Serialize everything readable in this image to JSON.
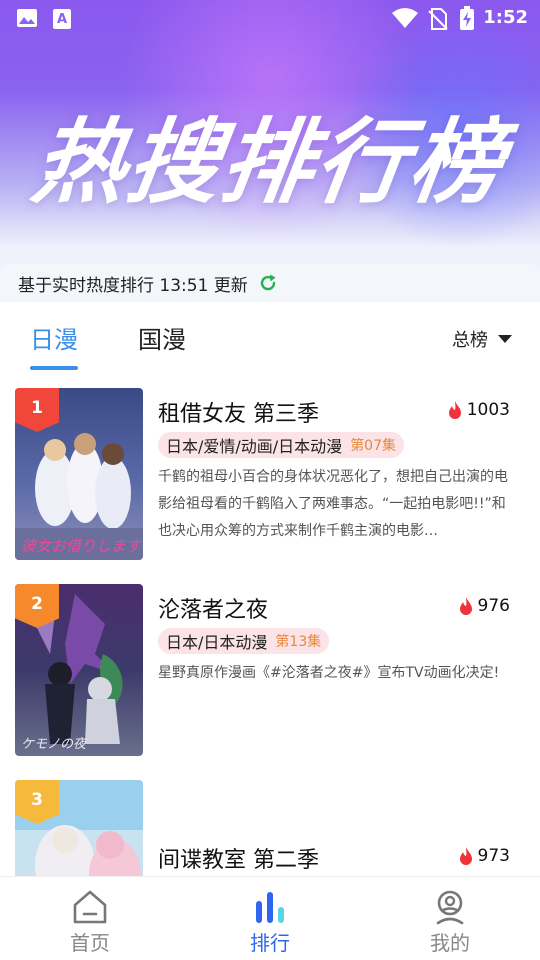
{
  "status_bar": {
    "time": "1:52",
    "left_icons": [
      "image-icon",
      "font-a-icon"
    ],
    "right_icons": [
      "wifi-icon",
      "no-sim-icon",
      "battery-charging-icon"
    ]
  },
  "hero": {
    "title": "热搜排行榜"
  },
  "update": {
    "text": "基于实时热度排行 13:51 更新",
    "icon": "refresh-icon",
    "icon_color": "#22b14c"
  },
  "tabs": {
    "active": "日漫",
    "inactive": "国漫",
    "accent": "#3a8fe8"
  },
  "sort": {
    "label": "总榜"
  },
  "items": [
    {
      "rank": "1",
      "rank_color": "#f0473a",
      "title": "租借女友 第三季",
      "heat": "1003",
      "genre": "日本/爱情/动画/日本动漫",
      "episode": "第07集",
      "desc": "千鹤的祖母小百合的身体状况恶化了，想把自己出演的电影给祖母看的千鹤陷入了两难事态。“一起拍电影吧!!”和也决心用众筹的方式来制作千鹤主演的电影…",
      "cover_caption": "彼女お借りします"
    },
    {
      "rank": "2",
      "rank_color": "#f5892c",
      "title": "沦落者之夜",
      "heat": "976",
      "genre": "日本/日本动漫",
      "episode": "第13集",
      "desc": "星野真原作漫画《#沦落者之夜#》宣布TV动画化决定!",
      "cover_caption": "ケモノの夜"
    },
    {
      "rank": "3",
      "rank_color": "#f6b93b",
      "title": "间谍教室 第二季",
      "heat": "973",
      "genre": "",
      "episode": "",
      "desc": "",
      "cover_caption": ""
    }
  ],
  "nav": {
    "home": "首页",
    "rank": "排行",
    "mine": "我的",
    "active_color": "#2e66f0",
    "inactive_color": "#888888"
  }
}
